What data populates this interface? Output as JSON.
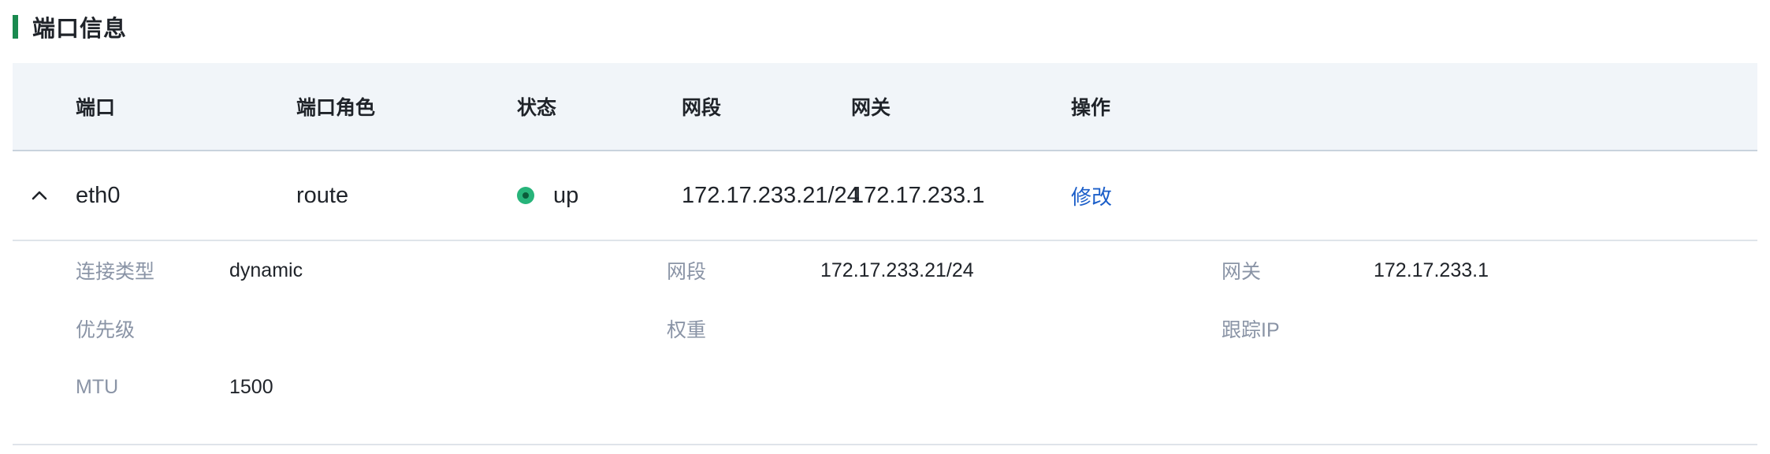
{
  "section": {
    "title": "端口信息",
    "accent_color": "#1a8a4f"
  },
  "table": {
    "columns": [
      "端口",
      "端口角色",
      "状态",
      "网段",
      "网关",
      "操作"
    ],
    "rows": [
      {
        "port": "eth0",
        "role": "route",
        "status": "up",
        "status_color": "#27b47a",
        "segment": "172.17.233.21/24",
        "gateway": "172.17.233.1",
        "action": "修改",
        "expanded": true,
        "details": {
          "conn_type_label": "连接类型",
          "conn_type_value": "dynamic",
          "segment_label": "网段",
          "segment_value": "172.17.233.21/24",
          "gateway_label": "网关",
          "gateway_value": "172.17.233.1",
          "priority_label": "优先级",
          "priority_value": "",
          "weight_label": "权重",
          "weight_value": "",
          "track_ip_label": "跟踪IP",
          "track_ip_value": "",
          "mtu_label": "MTU",
          "mtu_value": "1500"
        }
      }
    ]
  },
  "icons": {
    "expand_toggle": "chevron-up-icon",
    "status": "status-dot-icon"
  },
  "colors": {
    "header_bg": "#f1f5f9",
    "link": "#1b5ec9",
    "label": "#8a94a6"
  }
}
